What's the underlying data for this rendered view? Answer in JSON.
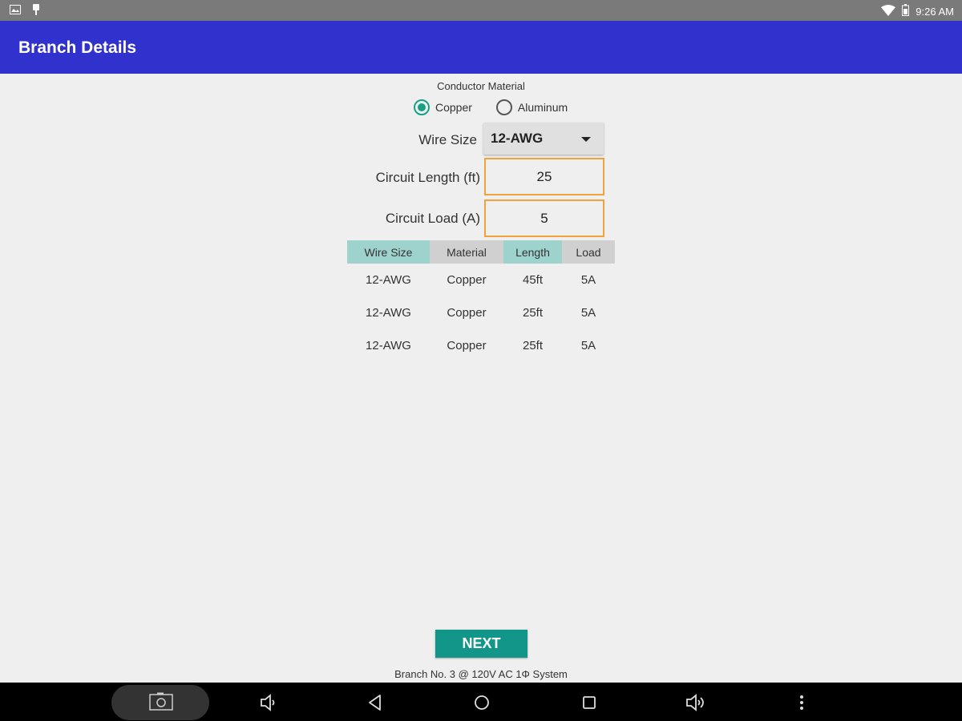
{
  "status_bar": {
    "time": "9:26 AM"
  },
  "app_bar": {
    "title": "Branch Details"
  },
  "conductor": {
    "label": "Conductor Material",
    "options": [
      "Copper",
      "Aluminum"
    ],
    "selected": "Copper"
  },
  "wire_size": {
    "label": "Wire Size",
    "value": "12-AWG"
  },
  "circuit_length": {
    "label": "Circuit Length (ft)",
    "value": "25"
  },
  "circuit_load": {
    "label": "Circuit Load (A)",
    "value": "5"
  },
  "table": {
    "headers": [
      "Wire Size",
      "Material",
      "Length",
      "Load"
    ],
    "rows": [
      [
        "12-AWG",
        "Copper",
        "45ft",
        "5A"
      ],
      [
        "12-AWG",
        "Copper",
        "25ft",
        "5A"
      ],
      [
        "12-AWG",
        "Copper",
        "25ft",
        "5A"
      ]
    ]
  },
  "next_button": {
    "label": "NEXT"
  },
  "footer": {
    "text": "Branch No. 3 @ 120V AC 1Φ System"
  },
  "colors": {
    "app_bar": "#3132cd",
    "accent": "#129689",
    "input_border": "#f0a23b"
  }
}
